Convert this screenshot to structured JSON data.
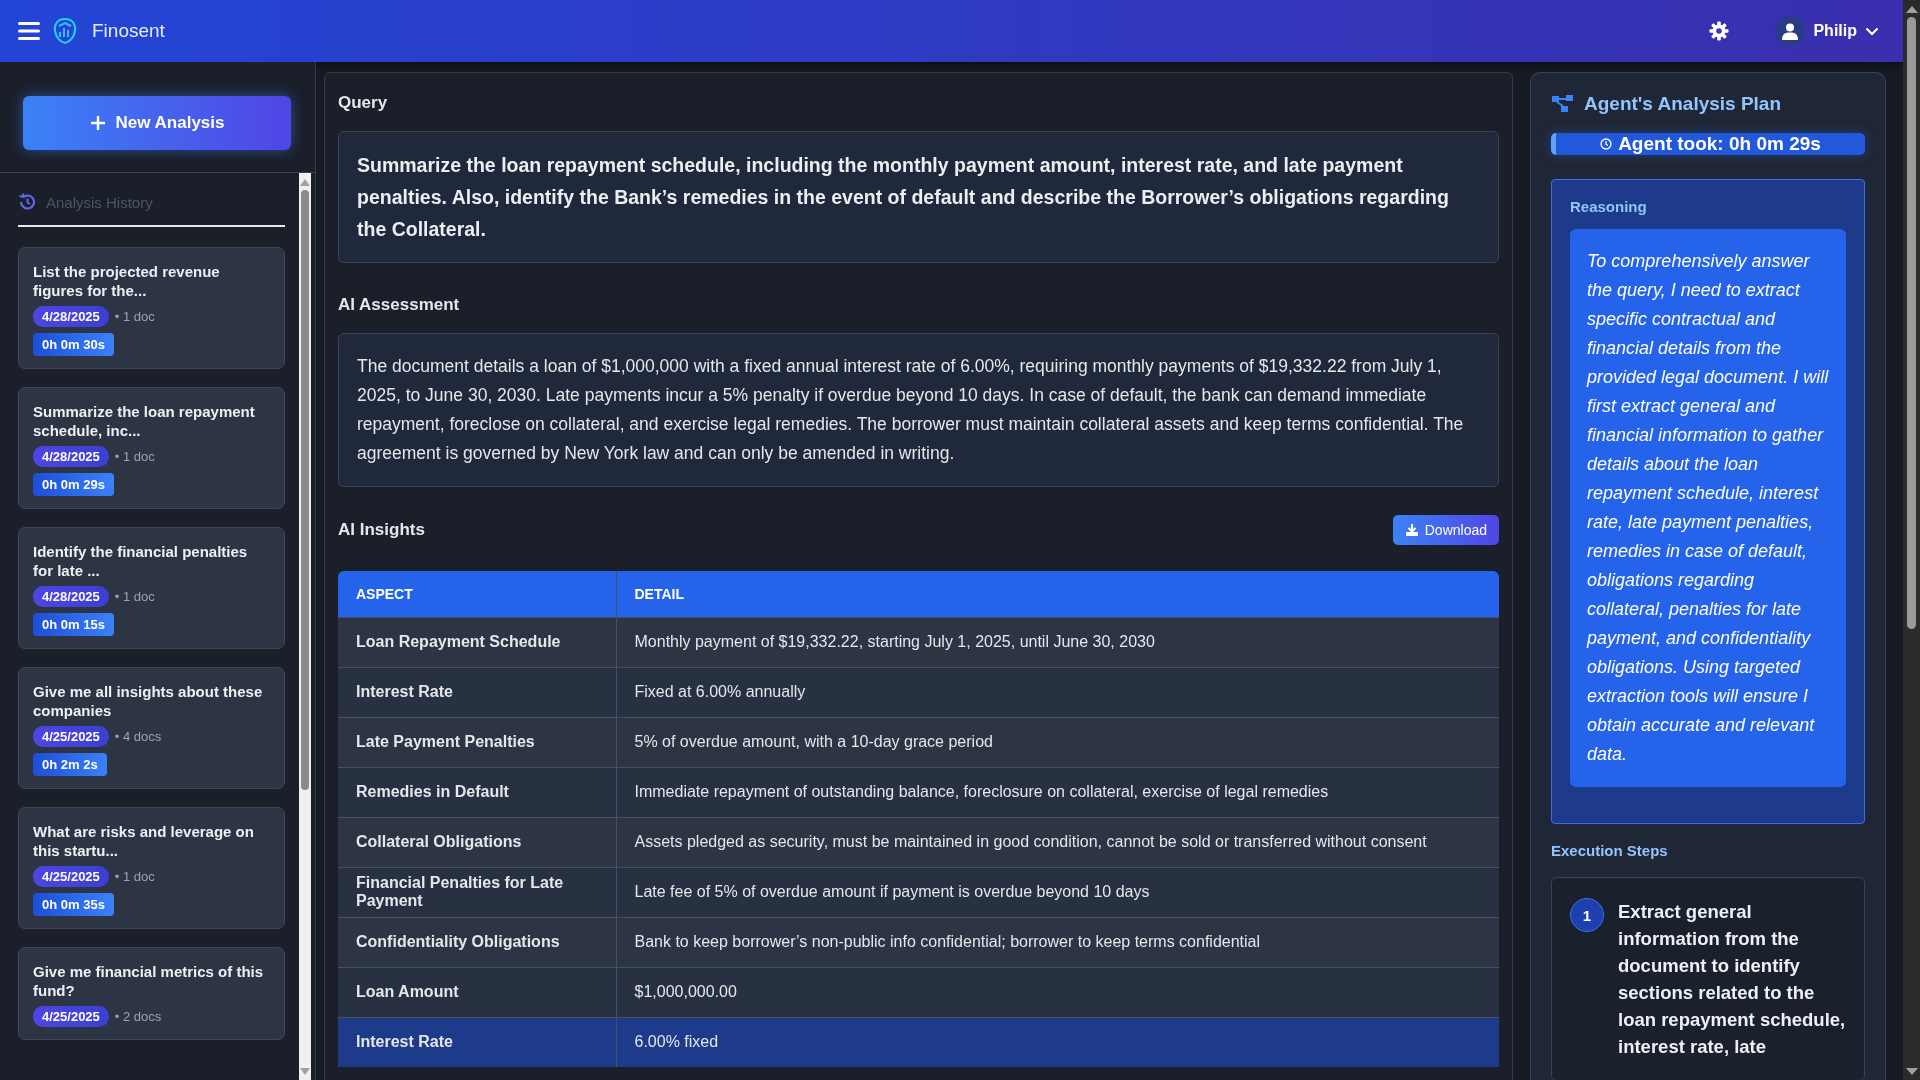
{
  "app": {
    "name": "Finosent",
    "user": "Philip"
  },
  "sidebar": {
    "new_button": "New Analysis",
    "history_title": "Analysis History",
    "items": [
      {
        "title": "List the projected revenue figures for the...",
        "date": "4/28/2025",
        "docs": "• 1 doc",
        "duration": "0h 0m 30s"
      },
      {
        "title": "Summarize the loan repayment schedule, inc...",
        "date": "4/28/2025",
        "docs": "• 1 doc",
        "duration": "0h 0m 29s"
      },
      {
        "title": "Identify the financial penalties for late ...",
        "date": "4/28/2025",
        "docs": "• 1 doc",
        "duration": "0h 0m 15s"
      },
      {
        "title": "Give me all insights about these companies",
        "date": "4/25/2025",
        "docs": "• 4 docs",
        "duration": "0h 2m 2s"
      },
      {
        "title": "What are risks and leverage on this startu...",
        "date": "4/25/2025",
        "docs": "• 1 doc",
        "duration": "0h 0m 35s"
      },
      {
        "title": "Give me financial metrics of this fund?",
        "date": "4/25/2025",
        "docs": "• 2 docs"
      }
    ]
  },
  "query": {
    "label": "Query",
    "text": "Summarize the loan repayment schedule, including the monthly payment amount, interest rate, and late payment penalties. Also, identify the Bank’s remedies in the event of default and describe the Borrower’s obligations regarding the Collateral."
  },
  "assessment": {
    "label": "AI Assessment",
    "text": "The document details a loan of $1,000,000 with a fixed annual interest rate of 6.00%, requiring monthly payments of $19,332.22 from July 1, 2025, to June 30, 2030. Late payments incur a 5% penalty if overdue beyond 10 days. In case of default, the bank can demand immediate repayment, foreclose on collateral, and exercise legal remedies. The borrower must maintain collateral assets and keep terms confidential. The agreement is governed by New York law and can only be amended in writing."
  },
  "insights": {
    "label": "AI Insights",
    "download": "Download",
    "columns": [
      "ASPECT",
      "DETAIL"
    ],
    "rows": [
      {
        "aspect": "Loan Repayment Schedule",
        "detail": "Monthly payment of $19,332.22, starting July 1, 2025, until June 30, 2030",
        "selected": false
      },
      {
        "aspect": "Interest Rate",
        "detail": "Fixed at 6.00% annually",
        "selected": false
      },
      {
        "aspect": "Late Payment Penalties",
        "detail": "5% of overdue amount, with a 10-day grace period",
        "selected": false
      },
      {
        "aspect": "Remedies in Default",
        "detail": "Immediate repayment of outstanding balance, foreclosure on collateral, exercise of legal remedies",
        "selected": false
      },
      {
        "aspect": "Collateral Obligations",
        "detail": "Assets pledged as security, must be maintained in good condition, cannot be sold or transferred without consent",
        "selected": false
      },
      {
        "aspect": "Financial Penalties for Late Payment",
        "detail": "Late fee of 5% of overdue amount if payment is overdue beyond 10 days",
        "selected": false
      },
      {
        "aspect": "Confidentiality Obligations",
        "detail": "Bank to keep borrower’s non-public info confidential; borrower to keep terms confidential",
        "selected": false
      },
      {
        "aspect": "Loan Amount",
        "detail": "$1,000,000.00",
        "selected": false
      },
      {
        "aspect": "Interest Rate",
        "detail": "6.00% fixed",
        "selected": true
      }
    ]
  },
  "plan": {
    "title": "Agent's Analysis Plan",
    "duration": "Agent took: 0h 0m 29s",
    "reasoning_label": "Reasoning",
    "reasoning": "To comprehensively answer the query, I need to extract specific contractual and financial details from the provided legal document. I will first extract general and financial information to gather details about the loan repayment schedule, interest rate, late payment penalties, remedies in case of default, obligations regarding collateral, penalties for late payment, and confidentiality obligations. Using targeted extraction tools will ensure I obtain accurate and relevant data.",
    "steps_label": "Execution Steps",
    "steps": [
      {
        "number": "1",
        "text": "Extract general information from the document to identify sections related to the loan repayment schedule, interest rate, late"
      }
    ]
  }
}
